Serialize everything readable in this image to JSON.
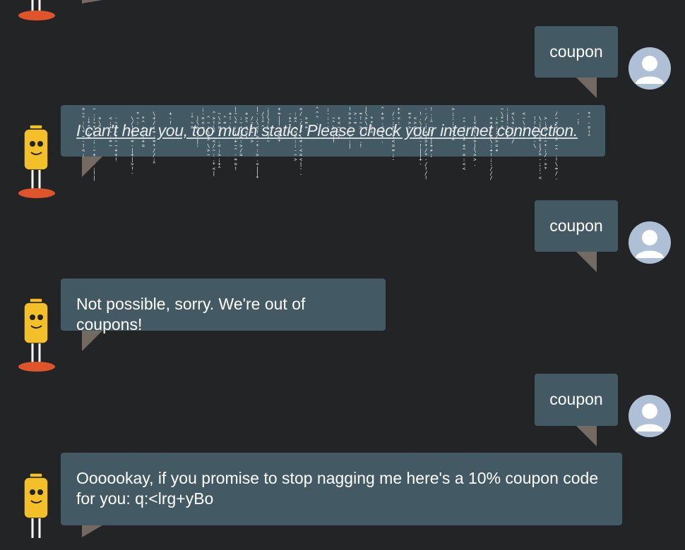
{
  "colors": {
    "background": "#222425",
    "bubble": "#435a65",
    "tail": "#736b63",
    "user_avatar_bg": "#aebfd6",
    "robot_body": "#f4c02a",
    "robot_base": "#e0542b"
  },
  "icons": {
    "user": "user-silhouette-icon",
    "bot": "robot-mascot-icon"
  },
  "messages": [
    {
      "sender": "user",
      "text": "coupon"
    },
    {
      "sender": "bot",
      "text": "I can't hear you, too much static! Please check your internet connection.",
      "style": "glitched"
    },
    {
      "sender": "user",
      "text": "coupon"
    },
    {
      "sender": "bot",
      "text": "Not possible, sorry. We're out of coupons!"
    },
    {
      "sender": "user",
      "text": "coupon"
    },
    {
      "sender": "bot",
      "text": "Oooookay, if you promise to stop nagging me here's a 10% coupon code for you: q:<lrg+yBo"
    }
  ]
}
